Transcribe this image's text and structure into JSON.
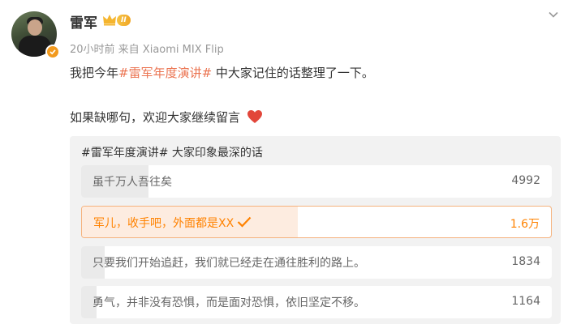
{
  "post": {
    "username": "雷军",
    "level_badge": "II",
    "meta": "20小时前 来自 Xiaomi MIX Flip",
    "line1_prefix": "我把今年",
    "line1_hashtag": "#雷军年度演讲#",
    "line1_suffix": " 中大家记住的话整理了一下。",
    "line2": "如果缺哪句，欢迎大家继续留言"
  },
  "poll": {
    "title": "#雷军年度演讲# 大家印象最深的话",
    "options": [
      {
        "label": "虽千万人吾往矣",
        "count": "4992",
        "fill": 0.31,
        "selected": false
      },
      {
        "label": "军儿，收手吧，外面都是XX",
        "count": "1.6万",
        "fill": 1.0,
        "selected": true
      },
      {
        "label": "只要我们开始追赶，我们就已经走在通往胜利的路上。",
        "count": "1834",
        "fill": 0.11,
        "selected": false
      },
      {
        "label": "勇气，并非没有恐惧，而是面对恐惧，依旧坚定不移。",
        "count": "1164",
        "fill": 0.07,
        "selected": false
      }
    ]
  },
  "colors": {
    "hashtag": "#eb7350",
    "selected": "#ff8200",
    "heart": "#e2463a"
  },
  "icons": [
    "avatar",
    "verified-badge-icon",
    "crown-icon",
    "chevron-down-icon",
    "heart-icon",
    "check-icon"
  ]
}
